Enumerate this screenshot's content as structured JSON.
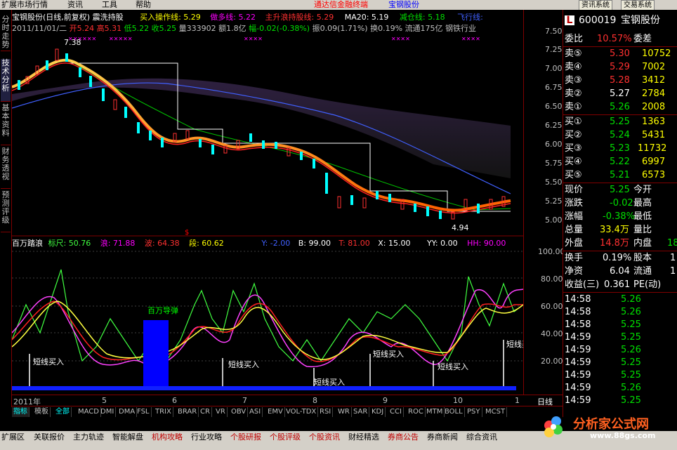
{
  "menubar": {
    "items": [
      "扩展市场行情",
      "资讯",
      "工具",
      "帮助"
    ],
    "center_brand": "通达信金融终端",
    "center_stock": "宝钢股份",
    "right_buttons": [
      "资讯系统",
      "交易系统"
    ]
  },
  "left_tabs": [
    "分时走势",
    "技术分析",
    "基本资料",
    "财务透视",
    "预测评级"
  ],
  "chart_header": {
    "line1": {
      "stock_name": "宝钢股份(日线,前复权)",
      "indicator": "震洗持股",
      "buy_line": "买入操作线: 5.29",
      "long_line": "做多线: 5.22",
      "trend_line": "主升浪持股线: 5.29",
      "ma20": "MA20: 5.19",
      "reduce_line": "减仓线: 5.18",
      "fly_line": "飞行线:"
    },
    "line2": {
      "date": "2011/11/01/二",
      "open": "开5.24",
      "high": "高5.31",
      "low": "低5.22",
      "close": "收5.25",
      "volume": "量333902",
      "amount": "额1.8亿",
      "change": "幅-0.02(-0.38%)",
      "amplitude": "振0.09(1.71%)",
      "turnover": "换0.19%",
      "float": "流通175亿",
      "industry": "钢铁行业"
    },
    "peak_label": "7.38",
    "trough_label": "4.94"
  },
  "sub_header": {
    "name": "百万踏浪",
    "biaochi": "标尺: 50.76",
    "lang": "浪: 71.88",
    "bo": "波: 64.38",
    "duan": "段: 60.62",
    "y": "Y: -2.00",
    "b": "B: 99.00",
    "t": "T: 81.00",
    "x": "X: 15.00",
    "yy": "YY: 0.00",
    "hh": "HH: 90.00"
  },
  "sub_annotations": {
    "guide": "百万导弹",
    "short_buy": "短线买入"
  },
  "price_axis": [
    "7.50",
    "7.25",
    "7.00",
    "6.75",
    "6.50",
    "6.25",
    "6.00",
    "5.75",
    "5.50",
    "5.25",
    "5.00"
  ],
  "osc_axis": [
    "100.00",
    "80.00",
    "60.00",
    "40.00",
    "20.00"
  ],
  "time_axis": {
    "year": "2011年",
    "months": [
      "5",
      "6",
      "7",
      "8",
      "9",
      "10",
      "1"
    ],
    "period": "日线"
  },
  "quote": {
    "code": "600019",
    "name": "宝钢股份",
    "weibi_label": "委比",
    "weibi_value": "10.57%",
    "weicha_label": "委差",
    "sell": [
      {
        "label": "卖⑤",
        "price": "5.30",
        "vol": "10752"
      },
      {
        "label": "卖④",
        "price": "5.29",
        "vol": "7002"
      },
      {
        "label": "卖③",
        "price": "5.28",
        "vol": "3412"
      },
      {
        "label": "卖②",
        "price": "5.27",
        "vol": "2784"
      },
      {
        "label": "卖①",
        "price": "5.26",
        "vol": "2008"
      }
    ],
    "buy": [
      {
        "label": "买①",
        "price": "5.25",
        "vol": "1363"
      },
      {
        "label": "买②",
        "price": "5.24",
        "vol": "5431"
      },
      {
        "label": "买③",
        "price": "5.23",
        "vol": "11732"
      },
      {
        "label": "买④",
        "price": "5.22",
        "vol": "6997"
      },
      {
        "label": "买⑤",
        "price": "5.21",
        "vol": "6573"
      }
    ],
    "stats": [
      {
        "l1": "现价",
        "v1": "5.25",
        "l2": "今开"
      },
      {
        "l1": "涨跌",
        "v1": "-0.02",
        "l2": "最高"
      },
      {
        "l1": "涨幅",
        "v1": "-0.38%",
        "l2": "最低"
      },
      {
        "l1": "总量",
        "v1": "33.4万",
        "l2": "量比"
      },
      {
        "l1": "外盘",
        "v1": "14.8万",
        "l2": "内盘",
        "v2": "18"
      },
      {
        "l1": "换手",
        "v1": "0.19%",
        "l2": "股本",
        "v2": "1"
      },
      {
        "l1": "净资",
        "v1": "6.04",
        "l2": "流通",
        "v2": "1"
      },
      {
        "l1": "收益(三)",
        "v1": "0.361",
        "l2": "PE(动)"
      }
    ],
    "ticks": [
      {
        "time": "14:58",
        "price": "5.26"
      },
      {
        "time": "14:58",
        "price": "5.26"
      },
      {
        "time": "14:58",
        "price": "5.25"
      },
      {
        "time": "14:59",
        "price": "5.25"
      },
      {
        "time": "14:59",
        "price": "5.26"
      },
      {
        "time": "14:59",
        "price": "5.25"
      },
      {
        "time": "14:59",
        "price": "5.25"
      },
      {
        "time": "14:59",
        "price": "5.26"
      },
      {
        "time": "14:59",
        "price": "5.25"
      }
    ]
  },
  "indicator_tabs": [
    "指标",
    "模板",
    "全部",
    "MACD",
    "DMI",
    "DMA",
    "FSL",
    "TRIX",
    "BRAR",
    "CR",
    "VR",
    "OBV",
    "ASI",
    "EMV",
    "VOL-TDX",
    "RSI",
    "WR",
    "SAR",
    "KDJ",
    "CCI",
    "ROC",
    "MTM",
    "BOLL",
    "PSY",
    "MCST"
  ],
  "bottom_tabs": [
    "扩展区",
    "关联报价",
    "主力轨迹",
    "智能解盘",
    "机构攻略",
    "行业攻略",
    "个股研报",
    "个股评级",
    "个股资讯",
    "财经精选",
    "券商公告",
    "券商新闻",
    "综合资讯"
  ],
  "logo": {
    "text": "分析家公式网",
    "url_text": "www.88gs.com"
  },
  "colors": {
    "up": "#ff3030",
    "down": "#00e000",
    "accent": "#00ffff",
    "border": "#800000"
  }
}
